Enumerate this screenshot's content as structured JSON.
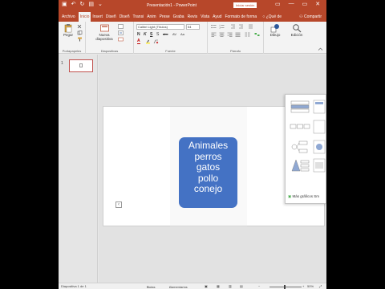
{
  "titlebar": {
    "title": "Presentación1 - PowerPoint",
    "signin": "Iniciar sesión",
    "minimize": "—",
    "restore": "▭",
    "close": "✕"
  },
  "tabs": [
    {
      "label": "Archivo"
    },
    {
      "label": "Inicio"
    },
    {
      "label": "Insert"
    },
    {
      "label": "Diseñ"
    },
    {
      "label": "Diseñ"
    },
    {
      "label": "Transi"
    },
    {
      "label": "Anim"
    },
    {
      "label": "Prese"
    },
    {
      "label": "Graba"
    },
    {
      "label": "Revis"
    },
    {
      "label": "Vista"
    },
    {
      "label": "Ayud"
    },
    {
      "label": "Formato de forma"
    }
  ],
  "tell_me": "¿Qué de",
  "share": "Compartir",
  "ribbon": {
    "paste_label": "Pegar",
    "new_slide_label": "Nueva diapositiva",
    "font_name": "Calibri Light (Títulos)",
    "font_size": "54",
    "bold": "N",
    "italic": "K",
    "underline": "S",
    "strike": "abc",
    "shadow": "S",
    "spacing": "AV",
    "font_color_letter": "A",
    "case": "Aa",
    "drawing_label": "Dibujo",
    "editing_label": "Edición",
    "groups": {
      "clipboard": "Portapapeles",
      "slides": "Diapositivas",
      "font": "Fuente",
      "paragraph": "Párrafo"
    }
  },
  "thumbnail": {
    "number": "1"
  },
  "slide": {
    "smartart_lines": [
      "Animales",
      "perros",
      "gatos",
      "pollo",
      "conejo"
    ],
    "handle_glyph": "‹"
  },
  "gallery": {
    "more_label": "Más gráficos Sm"
  },
  "statusbar": {
    "slide_info": "Diapositiva 1 de 1",
    "notes": "Notas",
    "comments": "Comentarios",
    "zoom": "50%"
  },
  "colors": {
    "accent": "#b7472a",
    "smartart": "#4472c4"
  }
}
